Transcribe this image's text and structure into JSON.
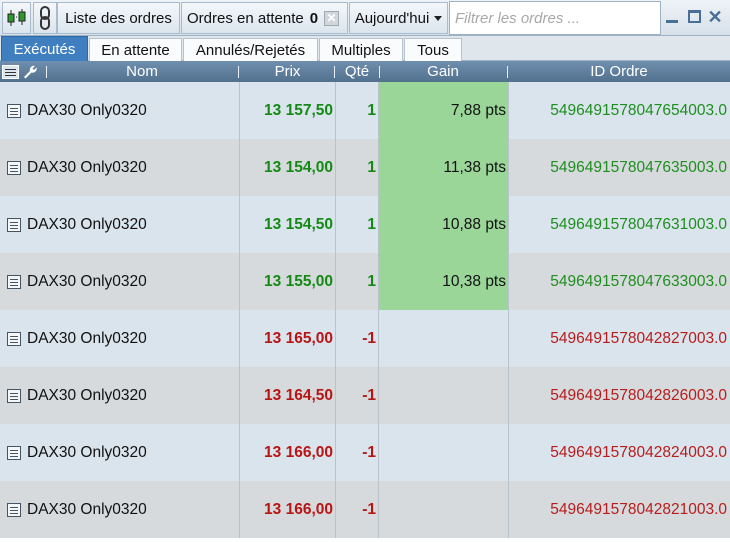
{
  "toolbar": {
    "orders_label": "Liste des ordres",
    "pending_label": "Ordres en attente",
    "pending_count": "0",
    "period_label": "Aujourd'hui",
    "filter_placeholder": "Filtrer les ordres ..."
  },
  "tabs": [
    {
      "label": "Exécutés",
      "active": true
    },
    {
      "label": "En attente",
      "active": false
    },
    {
      "label": "Annulés/Rejetés",
      "active": false
    },
    {
      "label": "Multiples",
      "active": false
    },
    {
      "label": "Tous",
      "active": false
    }
  ],
  "columns": {
    "nom": "Nom",
    "prix": "Prix",
    "qte": "Qté",
    "gain": "Gain",
    "id": "ID Ordre"
  },
  "rows": [
    {
      "nom": "DAX30 Only0320",
      "prix": "13 157,50",
      "qte": "1",
      "gain": "7,88 pts",
      "id": "5496491578047654003.0",
      "side": "buy"
    },
    {
      "nom": "DAX30 Only0320",
      "prix": "13 154,00",
      "qte": "1",
      "gain": "11,38 pts",
      "id": "5496491578047635003.0",
      "side": "buy"
    },
    {
      "nom": "DAX30 Only0320",
      "prix": "13 154,50",
      "qte": "1",
      "gain": "10,88 pts",
      "id": "5496491578047631003.0",
      "side": "buy"
    },
    {
      "nom": "DAX30 Only0320",
      "prix": "13 155,00",
      "qte": "1",
      "gain": "10,38 pts",
      "id": "5496491578047633003.0",
      "side": "buy"
    },
    {
      "nom": "DAX30 Only0320",
      "prix": "13 165,00",
      "qte": "-1",
      "gain": "",
      "id": "5496491578042827003.0",
      "side": "sell"
    },
    {
      "nom": "DAX30 Only0320",
      "prix": "13 164,50",
      "qte": "-1",
      "gain": "",
      "id": "5496491578042826003.0",
      "side": "sell"
    },
    {
      "nom": "DAX30 Only0320",
      "prix": "13 166,00",
      "qte": "-1",
      "gain": "",
      "id": "5496491578042824003.0",
      "side": "sell"
    },
    {
      "nom": "DAX30 Only0320",
      "prix": "13 166,00",
      "qte": "-1",
      "gain": "",
      "id": "5496491578042821003.0",
      "side": "sell"
    }
  ],
  "colors": {
    "active_tab": "#3f7fc0",
    "header": "#5a7a99",
    "buy": "#148a14",
    "sell": "#b81414",
    "gain_positive": "#9bd699"
  }
}
